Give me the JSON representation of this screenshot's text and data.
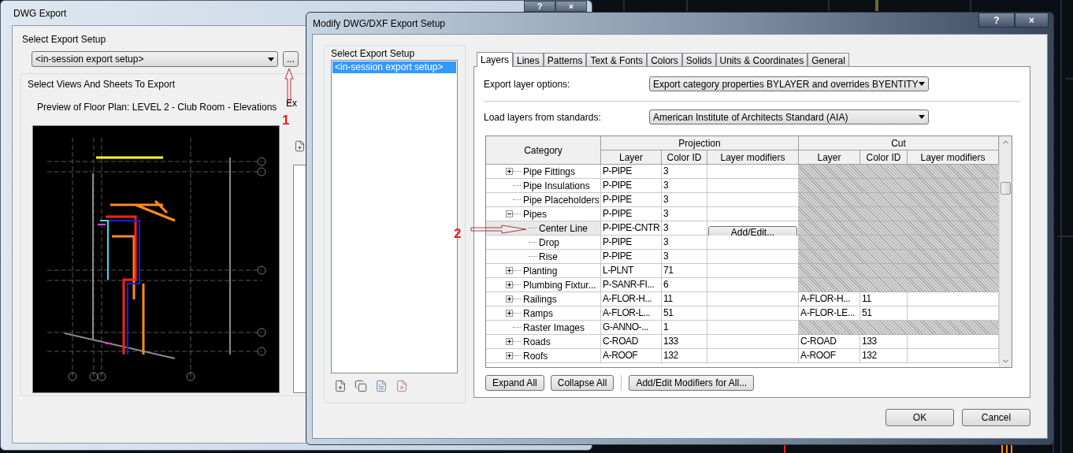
{
  "back_window": {
    "title": "DWG Export",
    "title_buttons": [
      "?",
      "×"
    ],
    "export_setup_label": "Select Export Setup",
    "export_setup_value": "<in-session export setup>",
    "browse_button": "...",
    "views_label": "Select Views And Sheets To Export",
    "preview_caption": "Preview of Floor Plan: LEVEL 2 - Club Room - Elevations",
    "partial_label": "Ex"
  },
  "annotations": [
    {
      "label": "1"
    },
    {
      "label": "2"
    }
  ],
  "dialog": {
    "title": "Modify DWG/DXF Export Setup",
    "title_buttons": [
      "?",
      "×"
    ],
    "setup_list_label": "Select Export Setup",
    "setups": [
      {
        "label": "<in-session export setup>",
        "selected": true
      }
    ],
    "tabs": [
      {
        "label": "Layers",
        "selected": true
      },
      {
        "label": "Lines",
        "selected": false
      },
      {
        "label": "Patterns",
        "selected": false
      },
      {
        "label": "Text & Fonts",
        "selected": false
      },
      {
        "label": "Colors",
        "selected": false
      },
      {
        "label": "Solids",
        "selected": false
      },
      {
        "label": "Units & Coordinates",
        "selected": false
      },
      {
        "label": "General",
        "selected": false
      }
    ],
    "export_layer_options": {
      "label": "Export layer options:",
      "value": "Export category properties BYLAYER and overrides BYENTITY"
    },
    "load_layers": {
      "label": "Load layers from standards:",
      "value": "American Institute of Architects Standard (AIA)"
    },
    "table": {
      "category_header": "Category",
      "groups": [
        "Projection",
        "Cut"
      ],
      "columns": [
        "Layer",
        "Color ID",
        "Layer modifiers",
        "Layer",
        "Color ID",
        "Layer modifiers"
      ],
      "rows": [
        {
          "category": "Pipe Fittings",
          "kind": "group",
          "expanded": false,
          "selected": false,
          "layer": "P-PIPE",
          "color_id": "3",
          "cut_disabled": true
        },
        {
          "category": "Pipe Insulations",
          "kind": "leaf",
          "selected": false,
          "layer": "P-PIPE",
          "color_id": "3",
          "cut_disabled": true
        },
        {
          "category": "Pipe Placeholders",
          "kind": "leaf",
          "selected": false,
          "layer": "P-PIPE",
          "color_id": "3",
          "cut_disabled": true
        },
        {
          "category": "Pipes",
          "kind": "group",
          "expanded": true,
          "selected": false,
          "layer": "P-PIPE",
          "color_id": "3",
          "cut_disabled": true,
          "children": [
            {
              "category": "Center Line",
              "kind": "leaf",
              "selected": true,
              "layer": "P-PIPE-CNTR",
              "color_id": "3",
              "modifiers_button": "Add/Edit...",
              "cut_disabled": true
            },
            {
              "category": "Drop",
              "kind": "leaf",
              "selected": false,
              "layer": "P-PIPE",
              "color_id": "3",
              "cut_disabled": true
            },
            {
              "category": "Rise",
              "kind": "leaf",
              "selected": false,
              "layer": "P-PIPE",
              "color_id": "3",
              "cut_disabled": true
            }
          ]
        },
        {
          "category": "Planting",
          "kind": "group",
          "expanded": false,
          "selected": false,
          "layer": "L-PLNT",
          "color_id": "71",
          "cut_disabled": true
        },
        {
          "category": "Plumbing Fixtur...",
          "kind": "group",
          "expanded": false,
          "selected": false,
          "layer": "P-SANR-FI...",
          "color_id": "6",
          "cut_disabled": true
        },
        {
          "category": "Railings",
          "kind": "group",
          "expanded": false,
          "selected": false,
          "layer": "A-FLOR-H...",
          "color_id": "11",
          "cut_disabled": false,
          "cut_layer": "A-FLOR-H...",
          "cut_color_id": "11"
        },
        {
          "category": "Ramps",
          "kind": "group",
          "expanded": false,
          "selected": false,
          "layer": "A-FLOR-L...",
          "color_id": "51",
          "cut_disabled": false,
          "cut_layer": "A-FLOR-LE...",
          "cut_color_id": "51"
        },
        {
          "category": "Raster Images",
          "kind": "leaf",
          "selected": false,
          "layer": "G-ANNO-...",
          "color_id": "1",
          "cut_disabled": true
        },
        {
          "category": "Roads",
          "kind": "group",
          "expanded": false,
          "selected": false,
          "layer": "C-ROAD",
          "color_id": "133",
          "cut_disabled": false,
          "cut_layer": "C-ROAD",
          "cut_color_id": "133"
        },
        {
          "category": "Roofs",
          "kind": "group",
          "expanded": false,
          "selected": false,
          "layer": "A-ROOF",
          "color_id": "132",
          "cut_disabled": false,
          "cut_layer": "A-ROOF",
          "cut_color_id": "132"
        }
      ]
    },
    "table_buttons": [
      "Expand All",
      "Collapse All",
      "Add/Edit Modifiers for All..."
    ],
    "buttons": [
      "OK",
      "Cancel"
    ]
  }
}
